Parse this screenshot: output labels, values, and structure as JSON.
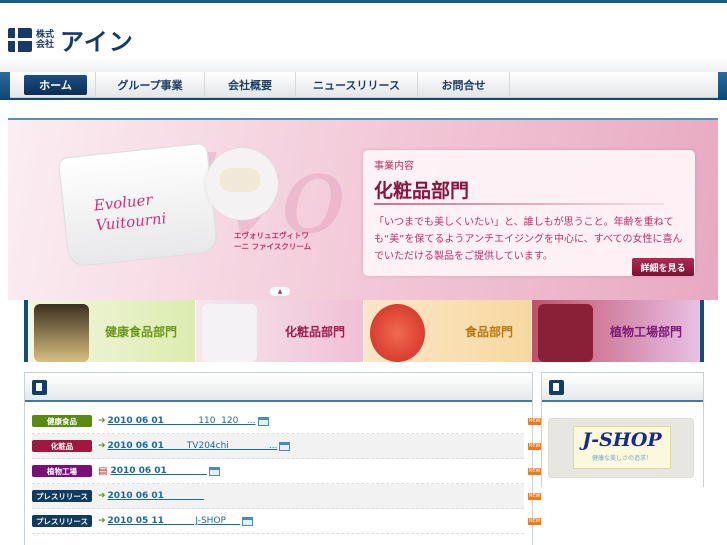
{
  "header": {
    "logo_small": "株式会社",
    "logo_name": "アイン"
  },
  "nav": [
    {
      "label": "ホーム"
    },
    {
      "label": "グループ事業"
    },
    {
      "label": "会社概要"
    },
    {
      "label": "ニュースリリース"
    },
    {
      "label": "お問合せ"
    }
  ],
  "hero": {
    "jar_text": "Evoluer Vuitourni",
    "product_name": "エヴォリュエヴィトワーニ ファイスクリーム",
    "kicker": "事業内容",
    "title": "化粧品部門",
    "body": "「いつまでも美しくいたい」と、誰しもが思うこと。年齢を重ねても“美”を保てるようアンチエイジングを中心に、すべての女性に喜んでいただける製品をご提供しています。",
    "more_label": "詳細を見る"
  },
  "categories": [
    {
      "label": "健康食品部門",
      "color": "#6a9a1a"
    },
    {
      "label": "化粧品部門",
      "color": "#a01c50"
    },
    {
      "label": "食品部門",
      "color": "#b87a10"
    },
    {
      "label": "植物工場部門",
      "color": "#7a1a7a"
    }
  ],
  "news": [
    {
      "tag": "健康食品",
      "tag_color": "#5a8a10",
      "date": "2010 06 01",
      "text": "            110  120   ...",
      "icon": "arrow"
    },
    {
      "tag": "化粧品",
      "tag_color": "#a0183f",
      "date": "2010 06 01",
      "text": "        TV204chi              ...",
      "icon": "arrow"
    },
    {
      "tag": "植物工場",
      "tag_color": "#7a0e7a",
      "date": "2010 06 01",
      "text": "              ",
      "icon": "pdf"
    },
    {
      "tag": "プレスリリース",
      "tag_color": "#0f3a62",
      "date": "2010 06 01",
      "text": "              ",
      "icon": "arrow"
    },
    {
      "tag": "プレスリリース",
      "tag_color": "#0f3a62",
      "date": "2010 05 11",
      "text": "           J-SHOP     ",
      "icon": "arrow"
    }
  ],
  "new_badge": "NEW",
  "jshop": {
    "title": "J-SHOP",
    "subtitle": "健康な美しさの追求！"
  }
}
